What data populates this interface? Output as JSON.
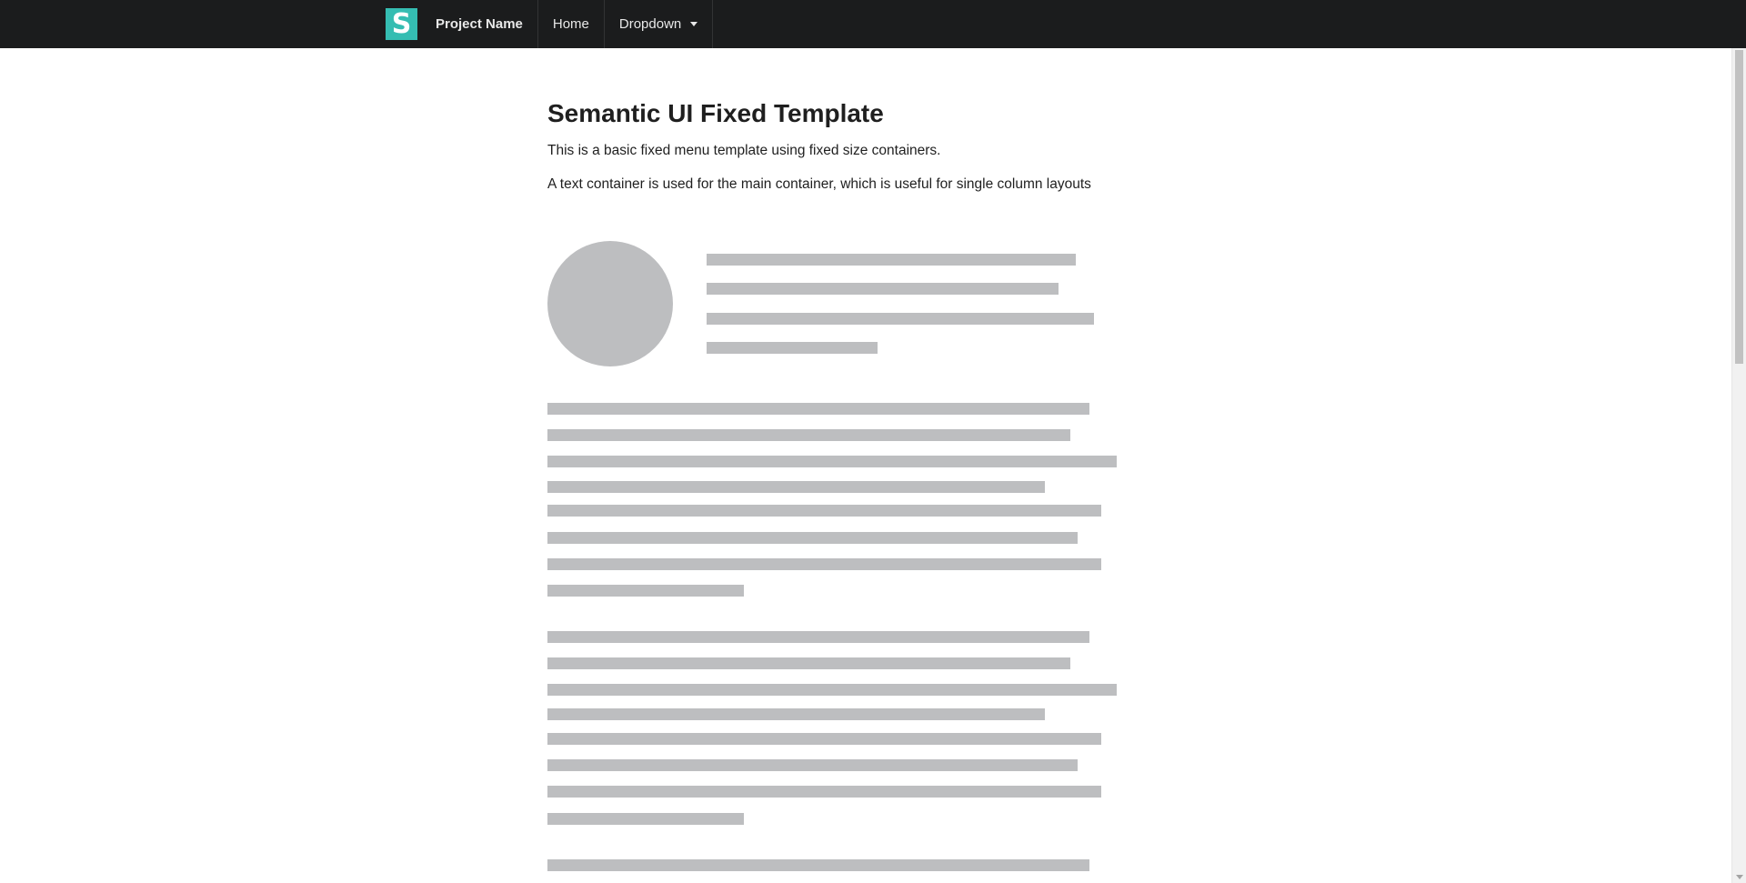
{
  "menu": {
    "logo_letter": "S",
    "project_name": "Project Name",
    "home_label": "Home",
    "dropdown_label": "Dropdown"
  },
  "main": {
    "title": "Semantic UI Fixed Template",
    "paragraphs": [
      "This is a basic fixed menu template using fixed size containers.",
      "A text container is used for the main container, which is useful for single column layouts"
    ]
  },
  "colors": {
    "menu_bg": "#1b1c1d",
    "logo_bg": "#35bdb2",
    "placeholder": "#bdbec0"
  }
}
